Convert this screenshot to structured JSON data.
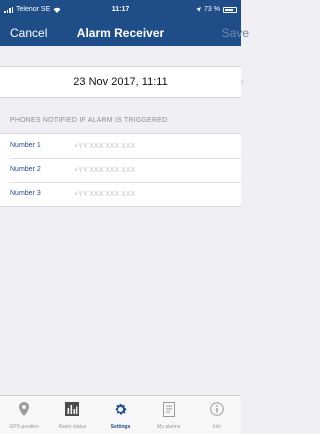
{
  "status_bar": {
    "carrier": "Telenor SE",
    "time": "11:17",
    "battery": "73 %"
  },
  "nav": {
    "cancel_label": "Cancel",
    "title": "Alarm Receiver",
    "save_label": "Save"
  },
  "date_cell": {
    "value": "23 Nov 2017, 11:11"
  },
  "phones": {
    "header": "PHONES NOTIFIED IF ALARM IS TRIGGERED",
    "rows": [
      {
        "label": "Number 1",
        "placeholder": "+YY XXX XXX XXX",
        "value": ""
      },
      {
        "label": "Number 2",
        "placeholder": "+YY XXX XXX XXX",
        "value": ""
      },
      {
        "label": "Number 3",
        "placeholder": "+YY XXX XXX XXX",
        "value": ""
      }
    ]
  },
  "tabbar": {
    "active_index": 2,
    "tabs": [
      {
        "label": "GPS-position",
        "icon": "location-pin-icon"
      },
      {
        "label": "Alarm status",
        "icon": "bar-chart-icon"
      },
      {
        "label": "Settings",
        "icon": "gear-icon"
      },
      {
        "label": "My alarms",
        "icon": "document-list-icon"
      },
      {
        "label": "Info",
        "icon": "info-icon"
      }
    ]
  },
  "colors": {
    "nav_bg": "#1f4d88",
    "accent": "#1f4d88",
    "background": "#efeff4",
    "tab_inactive": "#9a9a9f"
  }
}
